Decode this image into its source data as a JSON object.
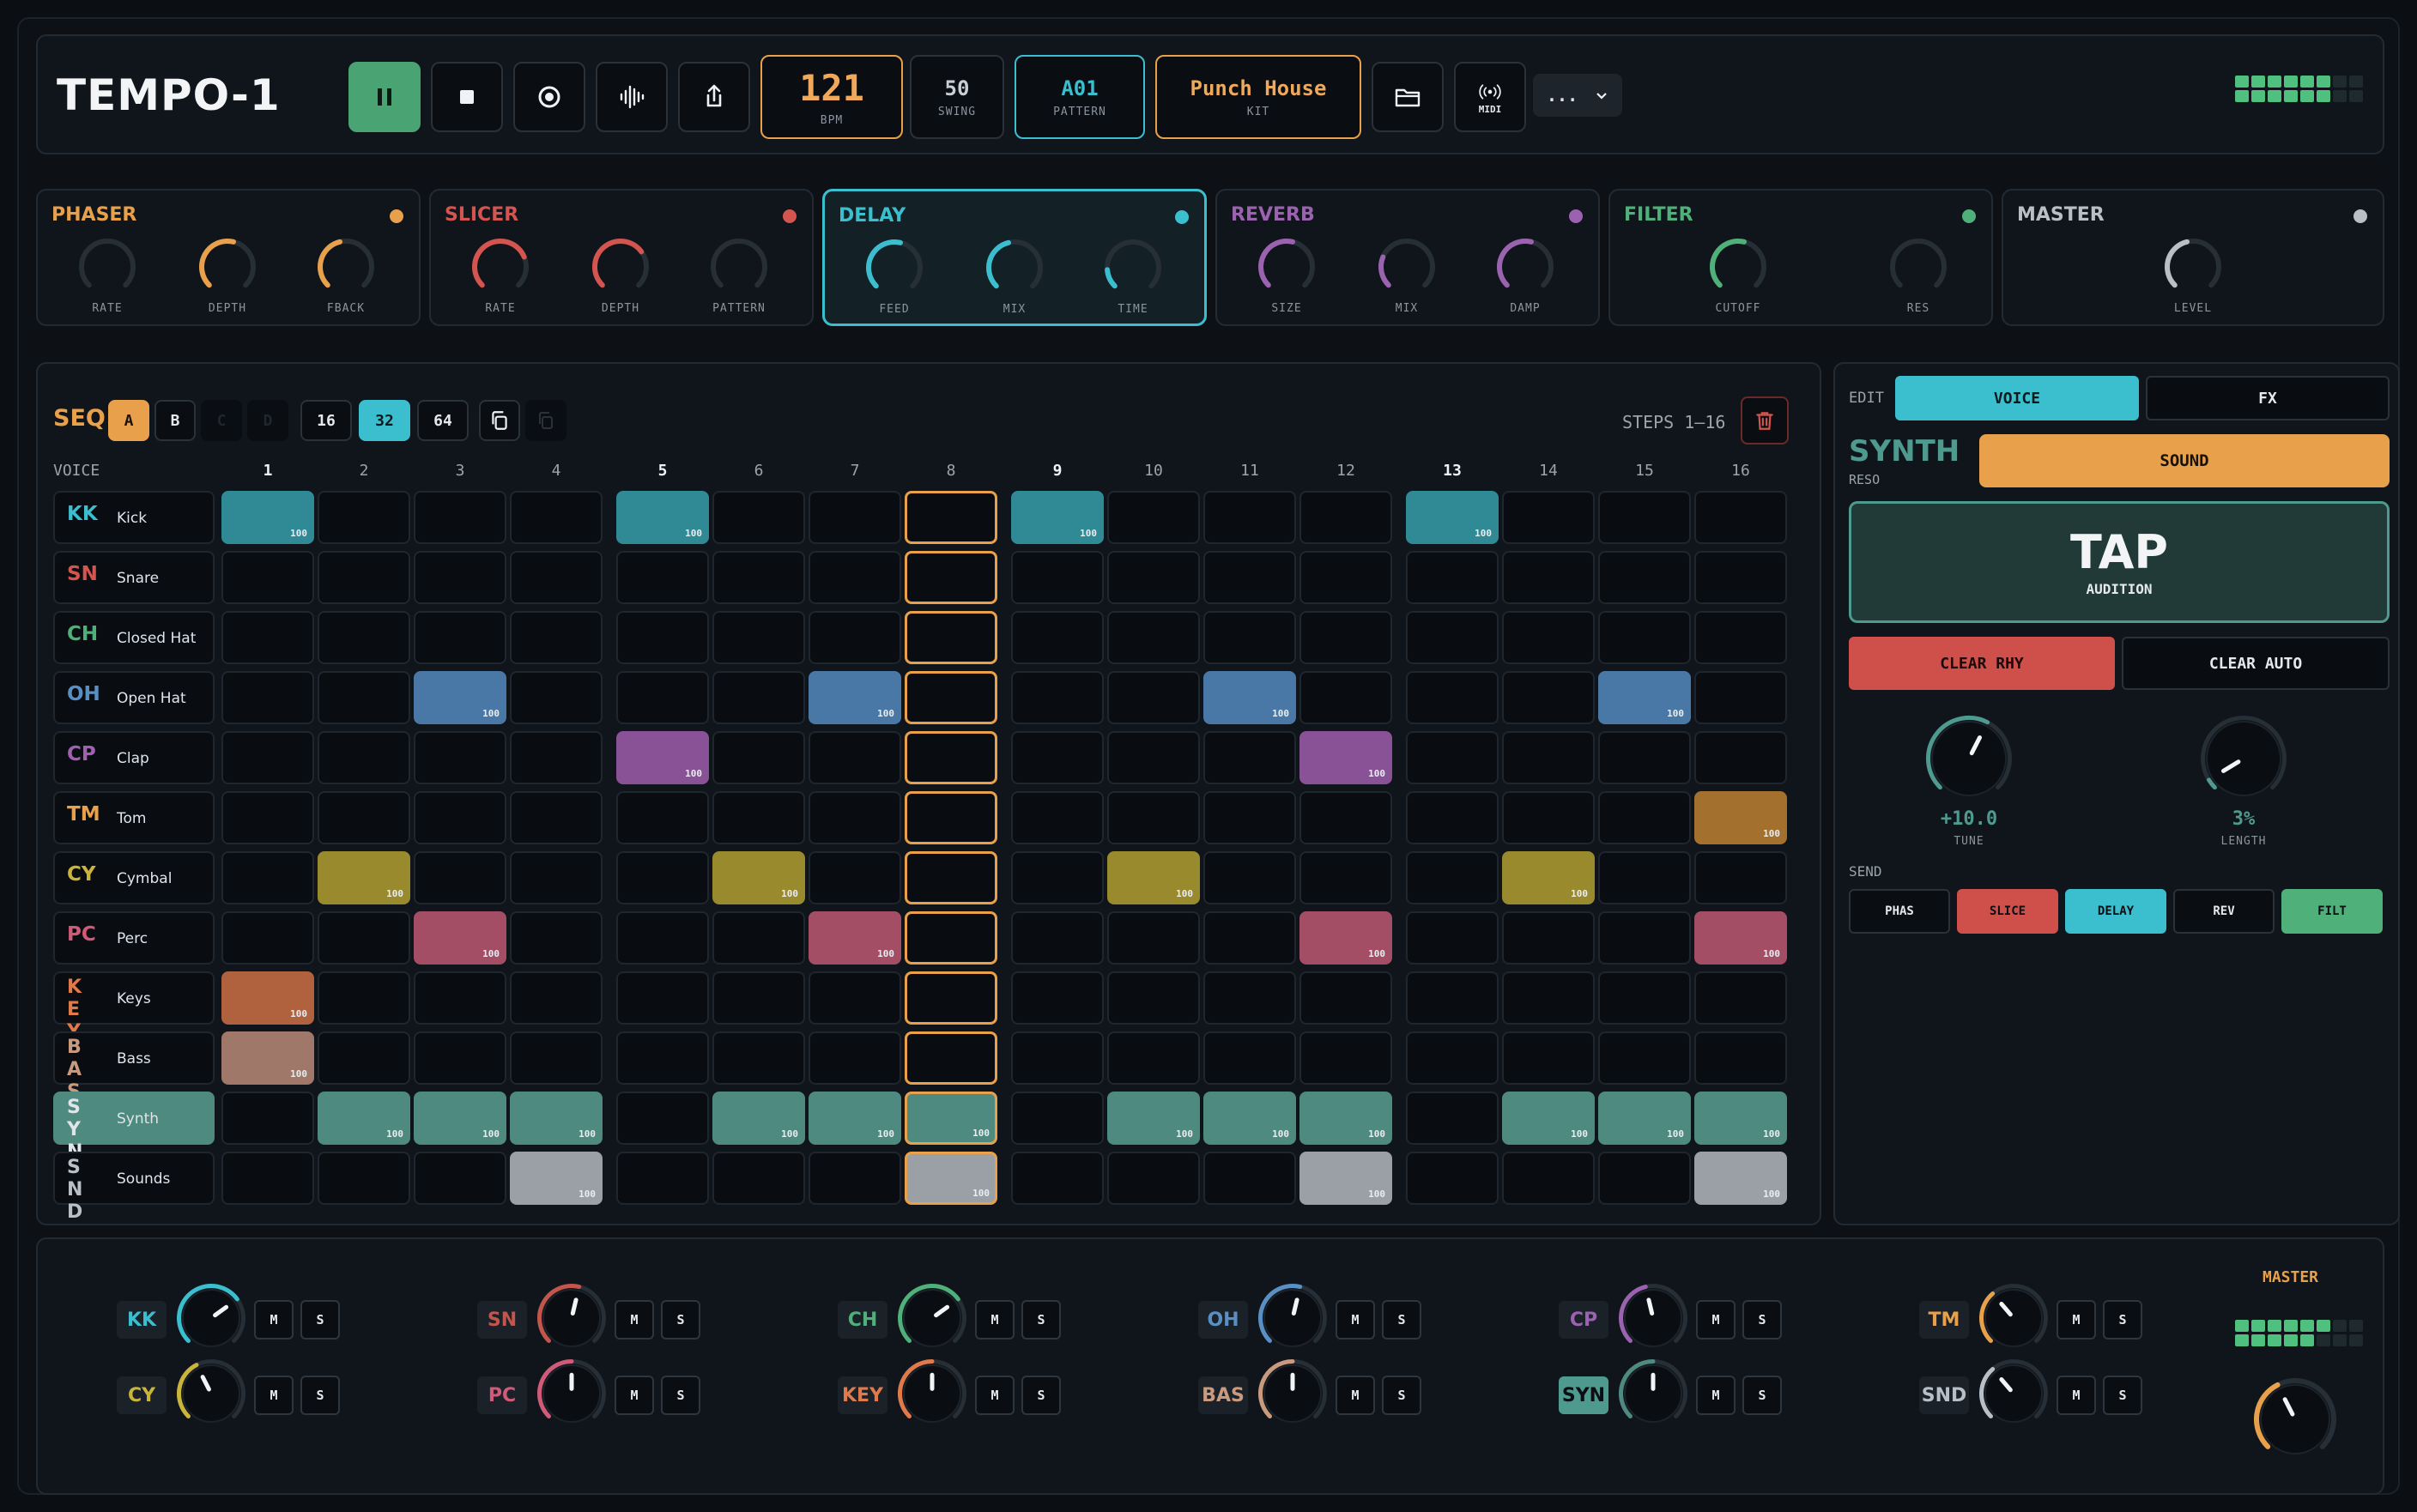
{
  "app": {
    "title": "TEMPO-1"
  },
  "header": {
    "bpm": {
      "value": "121",
      "label": "BPM"
    },
    "swing": {
      "value": "50",
      "label": "SWING"
    },
    "pattern": {
      "value": "A01",
      "label": "PATTERN"
    },
    "kit": {
      "value": "Punch House",
      "label": "KIT"
    },
    "midi_label": "MIDI",
    "more_label": "...",
    "icons": [
      "pause-icon",
      "stop-icon",
      "record-icon",
      "waveform-icon",
      "share-icon",
      "folder-icon",
      "midi-icon"
    ],
    "meter_level_fraction": 0.75
  },
  "fx": [
    {
      "name": "PHASER",
      "color": "#e8a14a",
      "knobs": [
        {
          "label": "RATE",
          "value": 0.0
        },
        {
          "label": "DEPTH",
          "value": 0.55
        },
        {
          "label": "FBACK",
          "value": 0.45
        }
      ]
    },
    {
      "name": "SLICER",
      "color": "#d4544f",
      "knobs": [
        {
          "label": "RATE",
          "value": 0.75
        },
        {
          "label": "DEPTH",
          "value": 0.7
        },
        {
          "label": "PATTERN",
          "value": 0.0
        }
      ]
    },
    {
      "name": "DELAY",
      "color": "#3bbfcf",
      "knobs": [
        {
          "label": "FEED",
          "value": 0.55
        },
        {
          "label": "MIX",
          "value": 0.45
        },
        {
          "label": "TIME",
          "value": 0.15
        }
      ]
    },
    {
      "name": "REVERB",
      "color": "#9b62b0",
      "knobs": [
        {
          "label": "SIZE",
          "value": 0.55
        },
        {
          "label": "MIX",
          "value": 0.25
        },
        {
          "label": "DAMP",
          "value": 0.55
        }
      ]
    },
    {
      "name": "FILTER",
      "color": "#4fb07a",
      "knobs": [
        {
          "label": "CUTOFF",
          "value": 0.55
        },
        {
          "label": "RES",
          "value": 0.0
        }
      ]
    },
    {
      "name": "MASTER",
      "color": "#b8bfc6",
      "knobs": [
        {
          "label": "LEVEL",
          "value": 0.45
        }
      ]
    }
  ],
  "seq": {
    "title": "SEQ",
    "banks": [
      "A",
      "B",
      "C",
      "D"
    ],
    "lengths": [
      "16",
      "32",
      "64"
    ],
    "steps_label": "STEPS 1–16",
    "voice_header": "VOICE",
    "columns": [
      "1",
      "2",
      "3",
      "4",
      "5",
      "6",
      "7",
      "8",
      "9",
      "10",
      "11",
      "12",
      "13",
      "14",
      "15",
      "16"
    ],
    "playhead_step": 8,
    "velocity_label": "100",
    "voices": [
      {
        "abbr": "KK",
        "name": "Kick",
        "color": "#2f8a96",
        "text": "#3bbfcf",
        "steps": [
          1,
          5,
          9,
          13
        ]
      },
      {
        "abbr": "SN",
        "name": "Snare",
        "color": "#c2554c",
        "text": "#d4544f",
        "steps": []
      },
      {
        "abbr": "CH",
        "name": "Closed Hat",
        "color": "#4fa07e",
        "text": "#4fb07a",
        "steps": []
      },
      {
        "abbr": "OH",
        "name": "Open Hat",
        "color": "#4a78a6",
        "text": "#5a8fc4",
        "steps": [
          3,
          7,
          11,
          15
        ]
      },
      {
        "abbr": "CP",
        "name": "Clap",
        "color": "#8a5296",
        "text": "#a062b0",
        "steps": [
          5,
          12
        ]
      },
      {
        "abbr": "TM",
        "name": "Tom",
        "color": "#a4702e",
        "text": "#e8a14a",
        "steps": [
          16
        ]
      },
      {
        "abbr": "CY",
        "name": "Cymbal",
        "color": "#9a8a2e",
        "text": "#cbb43a",
        "steps": [
          2,
          6,
          10,
          14
        ]
      },
      {
        "abbr": "PC",
        "name": "Perc",
        "color": "#a44e66",
        "text": "#d05a78",
        "steps": [
          3,
          7,
          12,
          16
        ]
      },
      {
        "abbr": "KEY",
        "name": "Keys",
        "color": "#b0623e",
        "text": "#e07a4a",
        "steps": [
          1
        ]
      },
      {
        "abbr": "BAS",
        "name": "Bass",
        "color": "#a0786a",
        "text": "#c99a7e",
        "steps": [
          1
        ]
      },
      {
        "abbr": "SYN",
        "name": "Synth",
        "color": "#4e8a80",
        "text": "#dfe5ea",
        "steps": [
          2,
          3,
          4,
          6,
          7,
          8,
          10,
          11,
          12,
          14,
          15,
          16
        ],
        "selected": true
      },
      {
        "abbr": "SND",
        "name": "Sounds",
        "color": "#9aa0a6",
        "text": "#b8bfc6",
        "steps": [
          4,
          8,
          12,
          16
        ]
      }
    ]
  },
  "side": {
    "edit_label": "EDIT",
    "tabs": [
      "VOICE",
      "FX"
    ],
    "voice_title": "SYNTH",
    "voice_sub": "RESO",
    "sound_label": "SOUND",
    "tap_label": "TAP",
    "tap_sub": "AUDITION",
    "clear_rhy": "CLEAR RHY",
    "clear_auto": "CLEAR AUTO",
    "tune": {
      "value": "+10.0",
      "label": "TUNE",
      "level": 0.6
    },
    "length": {
      "value": "3%",
      "label": "LENGTH",
      "level": 0.05
    },
    "send_label": "SEND",
    "sends": [
      {
        "label": "PHAS",
        "active": false,
        "color": ""
      },
      {
        "label": "SLICE",
        "active": true,
        "color": "#cf4f4b"
      },
      {
        "label": "DELAY",
        "active": true,
        "color": "#3bbfcf"
      },
      {
        "label": "REV",
        "active": false,
        "color": ""
      },
      {
        "label": "FILT",
        "active": true,
        "color": "#4fb07a"
      }
    ]
  },
  "mixer": {
    "master_label": "MASTER",
    "mute_label": "M",
    "solo_label": "S",
    "channels": [
      {
        "tag": "KK",
        "color": "#3bbfcf",
        "level": 0.7
      },
      {
        "tag": "SN",
        "color": "#c2554c",
        "level": 0.55
      },
      {
        "tag": "CH",
        "color": "#4fb07a",
        "level": 0.7
      },
      {
        "tag": "OH",
        "color": "#5a8fc4",
        "level": 0.55
      },
      {
        "tag": "CP",
        "color": "#9b62b0",
        "level": 0.45
      },
      {
        "tag": "TM",
        "color": "#e8a14a",
        "level": 0.35
      },
      {
        "tag": "CY",
        "color": "#cbb43a",
        "level": 0.4
      },
      {
        "tag": "PC",
        "color": "#d05a78",
        "level": 0.5
      },
      {
        "tag": "KEY",
        "color": "#e07a4a",
        "level": 0.5
      },
      {
        "tag": "BAS",
        "color": "#c99a7e",
        "level": 0.5
      },
      {
        "tag": "SYN",
        "color": "#4e8a80",
        "level": 0.5,
        "highlight": true
      },
      {
        "tag": "SND",
        "color": "#b8bfc6",
        "level": 0.35
      }
    ],
    "master_level": 0.4,
    "meter_level_fraction": 0.7
  }
}
